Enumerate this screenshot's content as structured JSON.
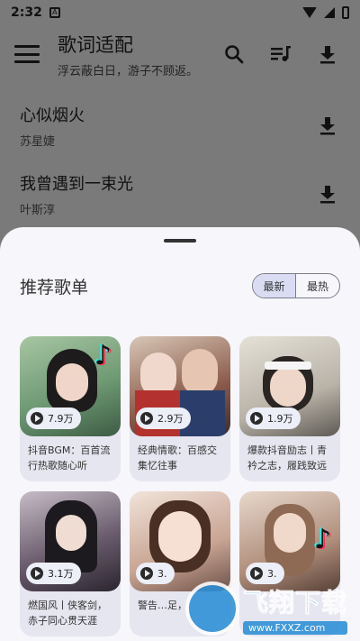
{
  "status": {
    "time": "2:32"
  },
  "appbar": {
    "title": "歌词适配",
    "subtitle": "浮云蔽白日，游子不顾返。"
  },
  "songs": [
    {
      "name": "心似烟火",
      "artist": "苏星婕"
    },
    {
      "name": "我曾遇到一束光",
      "artist": "叶斯淳"
    }
  ],
  "sheet": {
    "title": "推荐歌单",
    "tabs": [
      "最新",
      "最热"
    ],
    "active_tab": "最新"
  },
  "playlists": [
    {
      "plays": "7.9万",
      "title": "抖音BGM：百首流行热歌随心听",
      "cover_color": "#6f9a74"
    },
    {
      "plays": "2.9万",
      "title": "经典情歌：百感交集忆往事",
      "cover_color": "#8a5a4a"
    },
    {
      "plays": "1.9万",
      "title": "爆款抖音励志丨青衿之志，履践致远",
      "cover_color": "#b9b3a8"
    },
    {
      "plays": "3.1万",
      "title": "燃国风丨侠客剑，赤子同心贯天涯",
      "cover_color": "#6b5d6e"
    },
    {
      "plays": "3.",
      "title": "警告…足，",
      "cover_color": "#c8a493"
    },
    {
      "plays": "3.",
      "title": "",
      "cover_color": "#b08f7c"
    }
  ],
  "watermark": {
    "text": "飞翔下载",
    "url": "www.FXXZ.com"
  }
}
